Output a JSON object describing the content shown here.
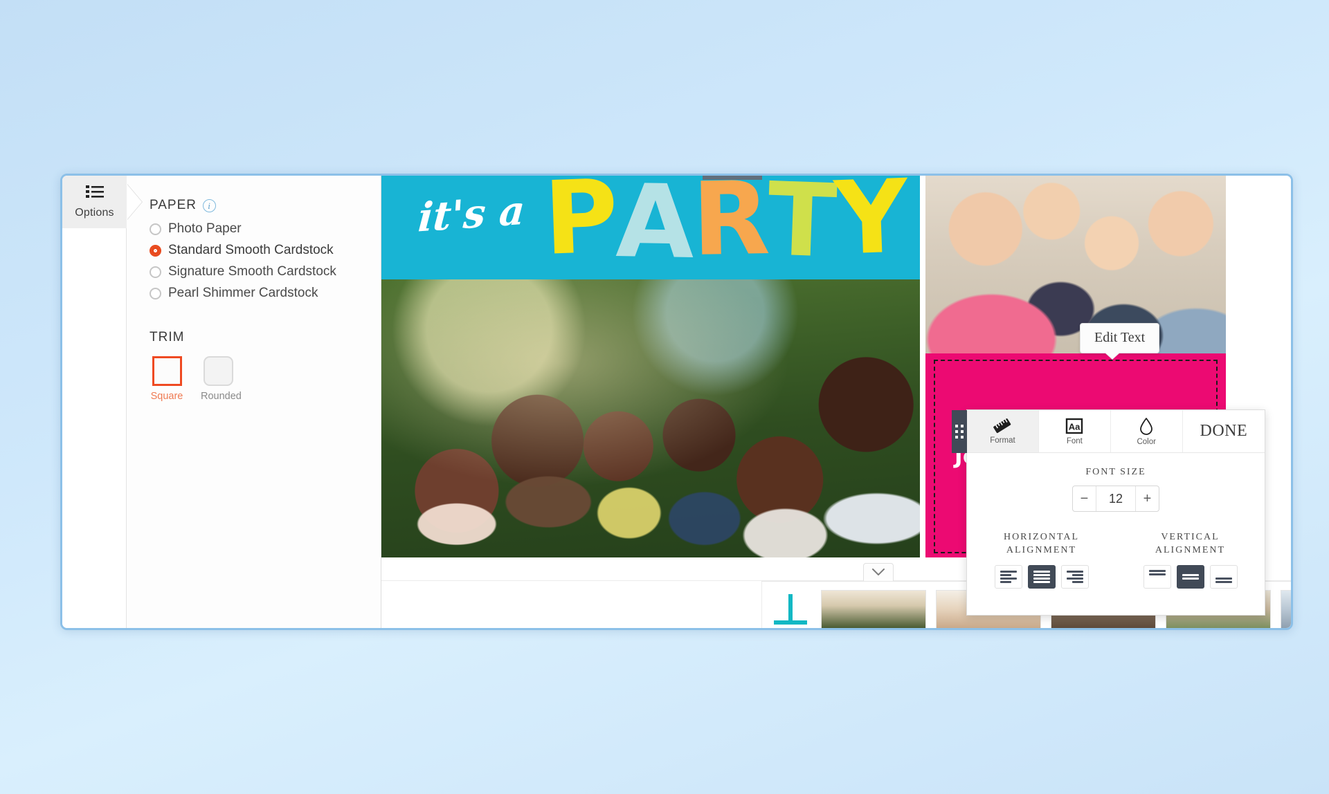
{
  "options_rail": {
    "tab_label": "Options",
    "tab_icon": "list-icon"
  },
  "options_panel": {
    "paper": {
      "heading": "PAPER",
      "info_icon": "info-icon",
      "selected": "Standard Smooth Cardstock",
      "choices": [
        {
          "label": "Photo Paper",
          "selected": false
        },
        {
          "label": "Standard Smooth Cardstock",
          "selected": true
        },
        {
          "label": "Signature Smooth Cardstock",
          "selected": false
        },
        {
          "label": "Pearl Shimmer Cardstock",
          "selected": false
        }
      ]
    },
    "trim": {
      "heading": "TRIM",
      "selected": "Square",
      "choices": [
        {
          "label": "Square",
          "selected": true
        },
        {
          "label": "Rounded",
          "selected": false
        }
      ]
    }
  },
  "card": {
    "banner": {
      "script_text": "it's a",
      "word": "PARTY",
      "letters": [
        "P",
        "A",
        "R",
        "T",
        "Y"
      ],
      "background_color": "#18b4d4",
      "letter_colors": [
        "#f5e216",
        "#b5e2e6",
        "#f7a74e",
        "#cfe04b",
        "#f5e216"
      ]
    },
    "left_photo_alt": "multi-generational family smiling outdoors",
    "right_photo_alt": "family of four piggyback smiling",
    "text_block": {
      "value": "Join your neighbors",
      "background_color": "#ec0a72",
      "text_color": "#ffffff",
      "selected": true
    },
    "edit_tooltip": "Edit Text",
    "add_button_label": "+"
  },
  "toolbar": {
    "drag_handle": "drag-handle",
    "tabs": [
      {
        "label": "Format",
        "icon": "ruler-icon",
        "active": true
      },
      {
        "label": "Font",
        "icon": "font-aa-icon",
        "active": false
      },
      {
        "label": "Color",
        "icon": "droplet-icon",
        "active": false
      }
    ],
    "done_label": "DONE",
    "font_size": {
      "label": "FONT SIZE",
      "value": "12",
      "decrement_label": "−",
      "increment_label": "+"
    },
    "horizontal_alignment": {
      "label_line1": "HORIZONTAL",
      "label_line2": "ALIGNMENT",
      "selected": "center",
      "options": [
        "left",
        "center",
        "right"
      ]
    },
    "vertical_alignment": {
      "label_line1": "VERTICAL",
      "label_line2": "ALIGNMENT",
      "selected": "middle",
      "options": [
        "top",
        "middle",
        "bottom"
      ]
    }
  },
  "tray": {
    "collapse_icon": "chevron-down-icon",
    "thumbnails": [
      {
        "alt": "man in brown hat outdoors"
      },
      {
        "alt": "two people with mountain backdrop"
      },
      {
        "alt": "people indoors at market"
      },
      {
        "alt": "family with wreath"
      },
      {
        "alt": "photo thumbnail"
      }
    ]
  }
}
